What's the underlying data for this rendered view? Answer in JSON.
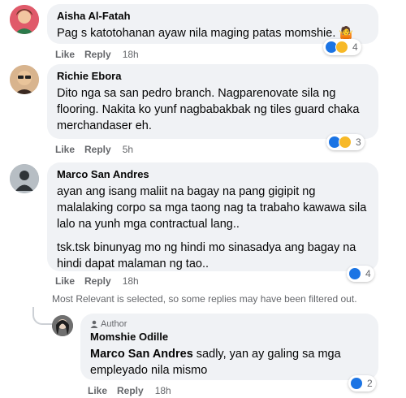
{
  "comments": [
    {
      "author": "Aisha Al-Fatah",
      "text": "Pag s katotohanan ayaw nila maging patas momshie. 🤷",
      "like": "Like",
      "reply": "Reply",
      "time": "18h",
      "reactions": [
        "like-icon",
        "sad-icon"
      ],
      "reaction_count": "4"
    },
    {
      "author": "Richie Ebora",
      "text": "Dito nga sa san pedro branch. Nagparenovate sila ng flooring. Nakita ko yunf nagbabakbak ng tiles guard chaka merchandaser eh.",
      "like": "Like",
      "reply": "Reply",
      "time": "5h",
      "reactions": [
        "like-icon",
        "haha-icon"
      ],
      "reaction_count": "3"
    },
    {
      "author": "Marco San Andres",
      "text1": "ayan ang isang maliit na bagay na pang gigipit ng malalaking corpo sa mga taong nag ta trabaho kawawa sila lalo na yunh mga contractual lang..",
      "text2": "tsk.tsk binunyag mo ng hindi mo sinasadya ang bagay na hindi dapat malaman ng tao..",
      "like": "Like",
      "reply": "Reply",
      "time": "18h",
      "reactions": [
        "like-icon"
      ],
      "reaction_count": "4"
    }
  ],
  "filter_note": "Most Relevant is selected, so some replies may have been filtered out.",
  "reply": {
    "badge": "Author",
    "author": "Momshie Odille",
    "mention": "Marco San Andres",
    "text": " sadly, yan ay galing sa mga empleyado nila mismo",
    "like": "Like",
    "reply": "Reply",
    "time": "18h",
    "reactions": [
      "like-icon"
    ],
    "reaction_count": "2"
  },
  "colors": {
    "bubble": "#f0f2f5",
    "meta": "#65676b",
    "like_blue": "#1b74e4",
    "emoji_yellow": "#f7b928"
  }
}
